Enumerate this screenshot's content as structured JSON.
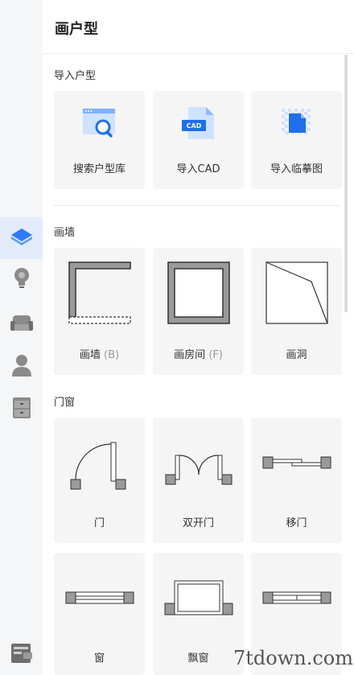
{
  "panel": {
    "title": "画户型"
  },
  "sections": {
    "import": {
      "title": "导入户型",
      "items": [
        {
          "label": "搜索户型库"
        },
        {
          "label": "导入CAD",
          "badge": "CAD"
        },
        {
          "label": "导入临摹图"
        }
      ]
    },
    "walls": {
      "title": "画墙",
      "items": [
        {
          "label": "画墙",
          "shortcut": "(B)"
        },
        {
          "label": "画房间",
          "shortcut": "(F)"
        },
        {
          "label": "画洞"
        }
      ]
    },
    "doors_windows": {
      "title": "门窗",
      "items": [
        {
          "label": "门"
        },
        {
          "label": "双开门"
        },
        {
          "label": "移门"
        },
        {
          "label": "窗"
        },
        {
          "label": "飘窗"
        },
        {
          "label": ""
        }
      ]
    }
  },
  "sidebar": {
    "items": [
      {
        "icon": "floorplan-icon",
        "active": true
      },
      {
        "icon": "lightbulb-icon",
        "active": false
      },
      {
        "icon": "sofa-icon",
        "active": false
      },
      {
        "icon": "person-icon",
        "active": false
      },
      {
        "icon": "cabinet-icon",
        "active": false
      }
    ],
    "bottom_icon": "layout-icon"
  },
  "watermark": {
    "text": "7tdown.com"
  },
  "colors": {
    "accent": "#2f7cf6",
    "active_bg": "#e3ebfb",
    "card_bg": "#f5f5f5",
    "wall_gray": "#9a9a9a"
  }
}
